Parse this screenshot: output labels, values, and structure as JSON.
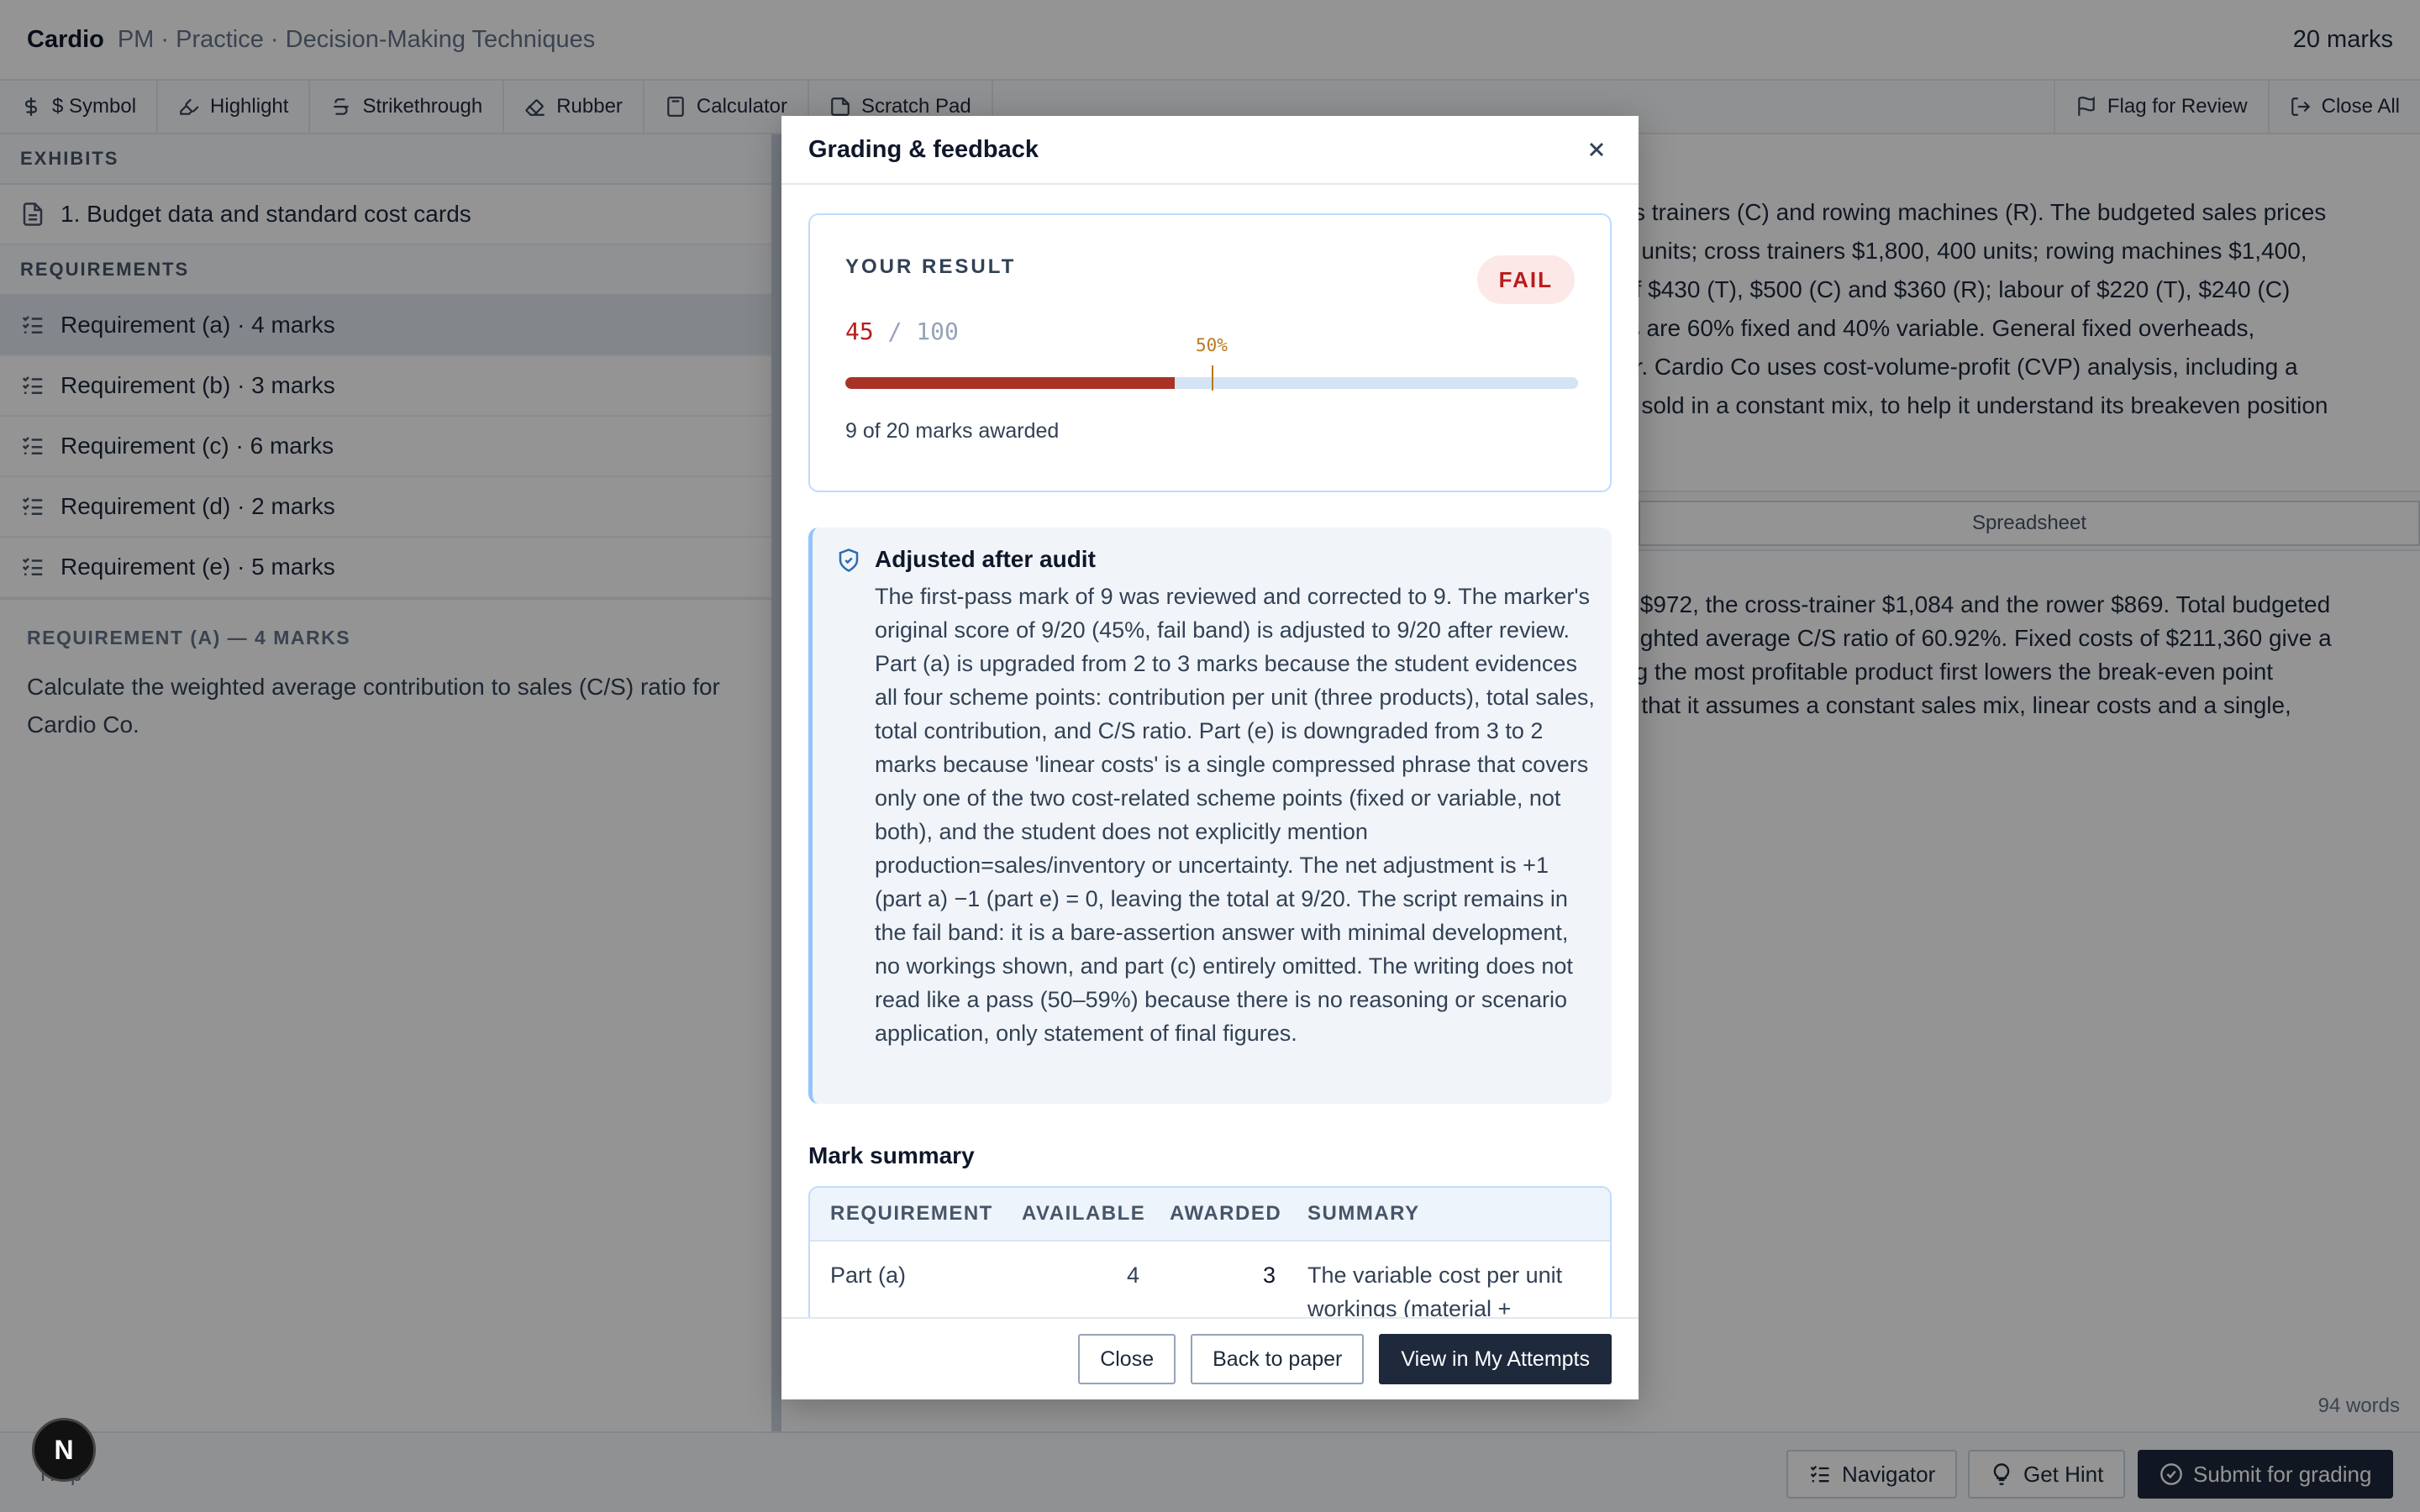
{
  "app": {
    "brand": "Cardio",
    "breadcrumb": "PM · Practice · Decision-Making Techniques",
    "total_marks": "20 marks"
  },
  "toolbar": {
    "items": [
      {
        "label": "$ Symbol",
        "icon": "dollar-icon"
      },
      {
        "label": "Highlight",
        "icon": "highlighter-icon"
      },
      {
        "label": "Strikethrough",
        "icon": "strikethrough-icon"
      },
      {
        "label": "Rubber",
        "icon": "eraser-icon"
      },
      {
        "label": "Calculator",
        "icon": "calculator-icon"
      },
      {
        "label": "Scratch Pad",
        "icon": "note-icon"
      }
    ],
    "flag": "Flag for Review",
    "close_all": "Close All"
  },
  "sidebar": {
    "exhibits_label": "EXHIBITS",
    "exhibits": [
      "1. Budget data and standard cost cards"
    ],
    "requirements_label": "REQUIREMENTS",
    "requirements": [
      "Requirement (a) · 4 marks",
      "Requirement (b) · 3 marks",
      "Requirement (c) · 6 marks",
      "Requirement (d) · 2 marks",
      "Requirement (e) · 5 marks"
    ],
    "detail_title": "REQUIREMENT (A) — 4 MARKS",
    "detail_text": "Calculate the weighted average contribution to sales (C/S) ratio for Cardio Co."
  },
  "scenario": {
    "lines": [
      "ss trainers (C) and rowing machines (R). The budgeted sales prices",
      "0 units; cross trainers $1,800, 400 units; rowing machines $1,400,",
      "of $430 (T), $500 (C) and $360 (R); labour of $220 (T), $240 (C)",
      "ts are 60% fixed and 40% variable. General fixed overheads,",
      "ar. Cardio Co uses cost-volume-profit (CVP) analysis, including a",
      "e sold in a constant mix, to help it understand its breakeven position"
    ],
    "tab_label": "Spreadsheet",
    "answer_lines": [
      "s $972, the cross-trainer $1,084 and the rower $869. Total budgeted",
      "eighted average C/S ratio of 60.92%. Fixed costs of $211,360 give a",
      "ng the most profitable product first lowers the break-even point",
      "e that it assumes a constant sales mix, linear costs and a single,"
    ],
    "word_count": "94 words"
  },
  "bottombar": {
    "help": "Help",
    "navigator": "Navigator",
    "hint": "Get Hint",
    "submit": "Submit for grading",
    "badge": "N"
  },
  "modal": {
    "title": "Grading & feedback",
    "result_label": "YOUR RESULT",
    "result_badge": "FAIL",
    "score": "45",
    "score_sep": "/",
    "score_max": "100",
    "score_fraction": 0.45,
    "pass_fraction": 0.5,
    "pass_label": "50%",
    "awarded_text": "9 of 20 marks awarded",
    "audit_title": "Adjusted after audit",
    "audit_text": "The first-pass mark of 9 was reviewed and corrected to 9. The marker's original score of 9/20 (45%, fail band) is adjusted to 9/20 after review. Part (a) is upgraded from 2 to 3 marks because the student evidences all four scheme points: contribution per unit (three products), total sales, total contribution, and C/S ratio. Part (e) is downgraded from 3 to 2 marks because 'linear costs' is a single compressed phrase that covers only one of the two cost-related scheme points (fixed or variable, not both), and the student does not explicitly mention production=sales/inventory or uncertainty. The net adjustment is +1 (part a) −1 (part e) = 0, leaving the total at 9/20. The script remains in the fail band: it is a bare-assertion answer with minimal development, no workings shown, and part (c) entirely omitted. The writing does not read like a pass (50–59%) because there is no reasoning or scenario application, only statement of final figures.",
    "mark_summary_title": "Mark summary",
    "table": {
      "headers": [
        "REQUIREMENT",
        "AVAILABLE",
        "AWARDED",
        "SUMMARY"
      ],
      "rows": [
        {
          "requirement": "Part (a)",
          "available": "4",
          "awarded": "3",
          "summary": "The variable cost per unit workings (material +"
        }
      ]
    },
    "buttons": {
      "close": "Close",
      "back": "Back to paper",
      "view": "View in My Attempts"
    }
  }
}
